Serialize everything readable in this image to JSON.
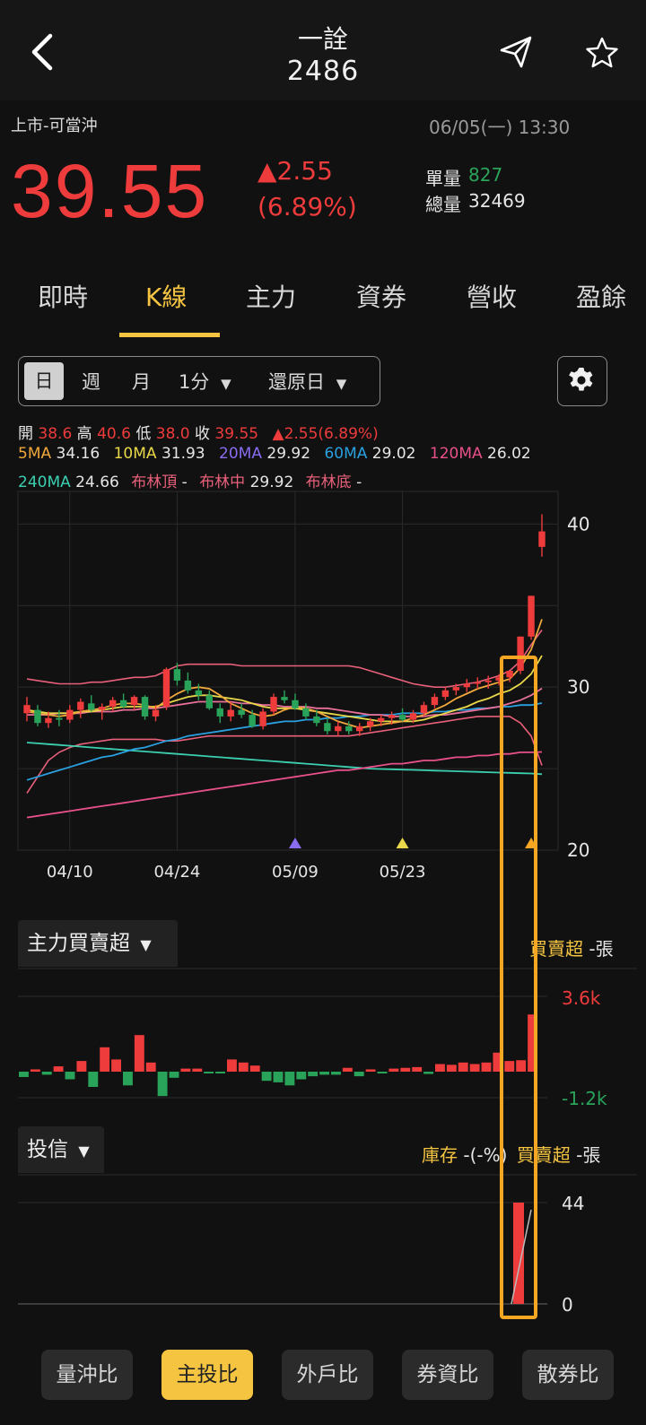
{
  "header": {
    "name": "一詮",
    "code": "2486"
  },
  "quote": {
    "market": "上市-可當沖",
    "datetime": "06/05(一) 13:30",
    "price": "39.55",
    "change": "▲2.55",
    "change_pct": "(6.89%)",
    "unit_vol_label": "單量",
    "unit_vol": "827",
    "total_vol_label": "總量",
    "total_vol": "32469"
  },
  "tabs": [
    "即時",
    "K線",
    "主力",
    "資券",
    "營收",
    "盈餘"
  ],
  "period": {
    "day": "日",
    "week": "週",
    "month": "月",
    "minute": "1分",
    "restore": "還原日"
  },
  "ohlc": {
    "open_label": "開",
    "open": "38.6",
    "high_label": "高",
    "high": "40.6",
    "low_label": "低",
    "low": "38.0",
    "close_label": "收",
    "close": "39.55",
    "change": "▲2.55(6.89%)"
  },
  "ma": {
    "ma5_label": "5MA",
    "ma5": "34.16",
    "ma10_label": "10MA",
    "ma10": "31.93",
    "ma20_label": "20MA",
    "ma20": "29.92",
    "ma60_label": "60MA",
    "ma60": "29.02",
    "ma120_label": "120MA",
    "ma120": "26.02",
    "ma240_label": "240MA",
    "ma240": "24.66",
    "boll_top_label": "布林頂",
    "boll_top": "-",
    "boll_mid_label": "布林中",
    "boll_mid": "29.92",
    "boll_bot_label": "布林底",
    "boll_bot": "-"
  },
  "colors": {
    "up": "#ee3b3b",
    "down": "#2aa35a",
    "accent": "#f5c542",
    "ma5": "#f0a83c",
    "ma10": "#e8d84a",
    "ma20": "#8a6cf0",
    "ma60": "#2aa0e0",
    "ma120": "#e8508a",
    "ma240": "#3ccfb0"
  },
  "chart_data": [
    {
      "type": "candlestick",
      "y_ticks": [
        "40",
        "30",
        "20"
      ],
      "ylim": [
        20,
        42
      ],
      "x_ticks": [
        "04/10",
        "04/24",
        "05/09",
        "05/23"
      ],
      "candles": [
        [
          28.4,
          29.4,
          27.9,
          28.9
        ],
        [
          28.6,
          28.9,
          27.6,
          27.8
        ],
        [
          27.8,
          28.5,
          27.5,
          28.1
        ],
        [
          28.1,
          28.6,
          27.6,
          28.0
        ],
        [
          28.0,
          28.9,
          27.8,
          28.6
        ],
        [
          28.6,
          29.3,
          28.1,
          29.1
        ],
        [
          29.0,
          29.5,
          28.5,
          28.6
        ],
        [
          28.6,
          29.0,
          28.0,
          28.8
        ],
        [
          28.8,
          29.4,
          28.5,
          29.2
        ],
        [
          29.2,
          29.6,
          28.7,
          28.8
        ],
        [
          28.9,
          29.5,
          28.6,
          29.4
        ],
        [
          29.4,
          29.5,
          28.0,
          28.2
        ],
        [
          28.2,
          28.9,
          27.9,
          28.6
        ],
        [
          28.8,
          31.2,
          28.6,
          31.1
        ],
        [
          31.1,
          31.5,
          30.1,
          30.4
        ],
        [
          30.4,
          30.9,
          29.6,
          29.8
        ],
        [
          29.8,
          30.2,
          29.2,
          29.5
        ],
        [
          29.5,
          29.8,
          28.6,
          28.7
        ],
        [
          28.7,
          29.0,
          27.8,
          28.2
        ],
        [
          28.2,
          29.1,
          27.9,
          28.6
        ],
        [
          28.6,
          29.0,
          28.1,
          28.3
        ],
        [
          28.3,
          28.6,
          27.5,
          27.6
        ],
        [
          27.6,
          28.7,
          27.4,
          28.5
        ],
        [
          28.5,
          29.6,
          28.3,
          29.4
        ],
        [
          29.4,
          29.8,
          29.0,
          29.2
        ],
        [
          29.2,
          29.6,
          28.6,
          28.7
        ],
        [
          28.7,
          29.0,
          28.0,
          28.2
        ],
        [
          28.2,
          28.6,
          27.6,
          27.8
        ],
        [
          27.8,
          28.1,
          27.1,
          27.3
        ],
        [
          27.3,
          27.9,
          27.0,
          27.6
        ],
        [
          27.6,
          27.9,
          27.1,
          27.3
        ],
        [
          27.3,
          27.8,
          27.0,
          27.6
        ],
        [
          27.6,
          28.1,
          27.3,
          27.9
        ],
        [
          27.9,
          28.3,
          27.6,
          28.1
        ],
        [
          28.1,
          28.5,
          27.7,
          28.3
        ],
        [
          28.3,
          28.7,
          27.9,
          28.0
        ],
        [
          28.0,
          28.6,
          27.8,
          28.4
        ],
        [
          28.4,
          29.1,
          28.2,
          28.9
        ],
        [
          28.9,
          29.6,
          28.7,
          29.4
        ],
        [
          29.4,
          30.0,
          29.2,
          29.8
        ],
        [
          29.8,
          30.2,
          29.5,
          30.0
        ],
        [
          30.0,
          30.5,
          29.7,
          30.2
        ],
        [
          30.2,
          30.6,
          29.9,
          30.3
        ],
        [
          30.3,
          30.7,
          29.9,
          30.4
        ],
        [
          30.4,
          30.8,
          30.1,
          30.6
        ],
        [
          30.6,
          31.0,
          30.3,
          31.0
        ],
        [
          31.0,
          33.1,
          30.8,
          33.1
        ],
        [
          33.1,
          35.6,
          32.9,
          35.6
        ],
        [
          38.6,
          40.6,
          38.0,
          39.55
        ]
      ],
      "ma5": [
        28.5,
        28.4,
        28.3,
        28.2,
        28.3,
        28.5,
        28.6,
        28.7,
        28.9,
        29.0,
        29.0,
        28.9,
        28.7,
        29.2,
        29.6,
        29.9,
        30.0,
        29.9,
        29.5,
        29.0,
        28.7,
        28.4,
        28.2,
        28.3,
        28.6,
        28.8,
        28.7,
        28.5,
        28.2,
        27.9,
        27.7,
        27.5,
        27.6,
        27.7,
        27.8,
        27.9,
        28.1,
        28.3,
        28.6,
        28.9,
        29.3,
        29.6,
        29.9,
        30.1,
        30.3,
        30.5,
        31.2,
        32.3,
        34.16
      ],
      "ma10": [
        28.6,
        28.5,
        28.4,
        28.4,
        28.4,
        28.5,
        28.5,
        28.6,
        28.7,
        28.8,
        28.8,
        28.8,
        28.8,
        29.0,
        29.2,
        29.4,
        29.5,
        29.5,
        29.4,
        29.3,
        29.2,
        29.0,
        28.8,
        28.7,
        28.7,
        28.7,
        28.6,
        28.5,
        28.4,
        28.3,
        28.2,
        28.1,
        28.0,
        27.9,
        27.9,
        27.9,
        27.9,
        28.0,
        28.2,
        28.4,
        28.6,
        28.8,
        29.1,
        29.3,
        29.6,
        29.8,
        30.2,
        30.8,
        31.93
      ],
      "ma20": [
        28.3,
        28.3,
        28.3,
        28.4,
        28.4,
        28.4,
        28.5,
        28.5,
        28.5,
        28.6,
        28.6,
        28.7,
        28.7,
        28.8,
        28.9,
        29.0,
        29.1,
        29.1,
        29.1,
        29.1,
        29.0,
        29.0,
        28.9,
        28.9,
        28.8,
        28.8,
        28.8,
        28.7,
        28.7,
        28.6,
        28.5,
        28.4,
        28.3,
        28.3,
        28.2,
        28.2,
        28.2,
        28.2,
        28.3,
        28.3,
        28.4,
        28.5,
        28.6,
        28.7,
        28.8,
        29.0,
        29.2,
        29.5,
        29.92
      ],
      "ma60": [
        24.3,
        24.5,
        24.7,
        24.9,
        25.1,
        25.3,
        25.5,
        25.7,
        25.8,
        26.0,
        26.2,
        26.3,
        26.5,
        26.7,
        26.8,
        27.0,
        27.1,
        27.2,
        27.3,
        27.4,
        27.5,
        27.6,
        27.7,
        27.8,
        27.9,
        27.9,
        28.0,
        28.0,
        28.1,
        28.1,
        28.2,
        28.2,
        28.3,
        28.3,
        28.3,
        28.4,
        28.4,
        28.4,
        28.5,
        28.5,
        28.6,
        28.6,
        28.7,
        28.7,
        28.8,
        28.8,
        28.9,
        28.9,
        29.02
      ],
      "ma120": [
        22.0,
        22.1,
        22.2,
        22.3,
        22.4,
        22.5,
        22.6,
        22.7,
        22.8,
        22.9,
        23.0,
        23.1,
        23.2,
        23.3,
        23.4,
        23.5,
        23.6,
        23.7,
        23.8,
        23.9,
        24.0,
        24.1,
        24.2,
        24.3,
        24.4,
        24.5,
        24.6,
        24.7,
        24.8,
        24.9,
        24.9,
        25.0,
        25.1,
        25.2,
        25.3,
        25.3,
        25.4,
        25.5,
        25.5,
        25.6,
        25.7,
        25.7,
        25.8,
        25.8,
        25.9,
        25.9,
        26.0,
        26.0,
        26.02
      ],
      "ma240": [
        26.6,
        26.55,
        26.5,
        26.45,
        26.4,
        26.35,
        26.3,
        26.25,
        26.2,
        26.15,
        26.1,
        26.05,
        26.0,
        25.95,
        25.9,
        25.85,
        25.8,
        25.75,
        25.7,
        25.65,
        25.6,
        25.55,
        25.5,
        25.45,
        25.4,
        25.35,
        25.3,
        25.25,
        25.2,
        25.15,
        25.1,
        25.05,
        25.0,
        24.98,
        24.96,
        24.94,
        24.92,
        24.9,
        24.88,
        24.86,
        24.84,
        24.82,
        24.8,
        24.78,
        24.76,
        24.74,
        24.72,
        24.7,
        24.66
      ],
      "boll_upper": [
        30.5,
        30.4,
        30.3,
        30.2,
        30.2,
        30.2,
        30.3,
        30.3,
        30.4,
        30.5,
        30.6,
        30.6,
        30.7,
        31.0,
        31.3,
        31.4,
        31.4,
        31.4,
        31.4,
        31.4,
        31.3,
        31.3,
        31.3,
        31.3,
        31.3,
        31.3,
        31.3,
        31.3,
        31.3,
        31.3,
        31.3,
        31.2,
        31.0,
        30.8,
        30.6,
        30.4,
        30.2,
        30.1,
        30.0,
        30.0,
        30.1,
        30.2,
        30.3,
        30.5,
        30.7,
        31.0,
        31.6,
        32.6,
        33.5
      ],
      "boll_lower": [
        23.5,
        24.5,
        25.5,
        26.0,
        26.3,
        26.5,
        26.6,
        26.7,
        26.8,
        26.8,
        26.8,
        26.8,
        26.8,
        26.7,
        26.7,
        26.8,
        26.9,
        27.0,
        27.0,
        27.0,
        27.0,
        27.0,
        27.0,
        27.0,
        27.0,
        27.0,
        27.0,
        27.0,
        27.0,
        27.0,
        27.0,
        27.1,
        27.2,
        27.3,
        27.4,
        27.5,
        27.6,
        27.7,
        27.8,
        27.9,
        28.0,
        28.1,
        28.2,
        28.2,
        28.2,
        28.2,
        27.8,
        27.0,
        25.2
      ]
    },
    {
      "type": "bar",
      "title": "主力買賣超",
      "y_ticks": [
        "3.6k",
        "-1.2k"
      ],
      "values": [
        -0.35,
        0.15,
        -0.2,
        0.35,
        -0.5,
        0.7,
        -1.0,
        1.6,
        0.8,
        -0.9,
        2.4,
        0.6,
        -1.6,
        -0.4,
        0.2,
        0.2,
        -0.1,
        -0.05,
        0.8,
        0.6,
        0.4,
        -0.6,
        -0.7,
        -0.9,
        -0.5,
        -0.3,
        -0.2,
        -0.2,
        0.25,
        -0.3,
        0.15,
        -0.1,
        0.2,
        0.25,
        0.3,
        -0.15,
        0.5,
        0.45,
        0.6,
        0.5,
        0.6,
        1.25,
        0.7,
        0.75,
        3.75
      ]
    },
    {
      "type": "bar",
      "title": "投信",
      "y_ticks": [
        "44",
        "0"
      ],
      "values": [
        0,
        0,
        0,
        0,
        0,
        0,
        0,
        0,
        0,
        0,
        0,
        0,
        0,
        0,
        0,
        0,
        0,
        0,
        0,
        0,
        0,
        0,
        0,
        0,
        0,
        0,
        0,
        0,
        0,
        0,
        0,
        0,
        0,
        0,
        0,
        0,
        0,
        0,
        0,
        0,
        0,
        0,
        0,
        0,
        0,
        0,
        0,
        0,
        44
      ]
    }
  ],
  "sub1": {
    "title": "主力買賣超",
    "right_label": "買賣超",
    "right_unit": "-張"
  },
  "sub2": {
    "title": "投信",
    "inv_label": "庫存",
    "inv_value": "-(-%)",
    "right_label": "買賣超",
    "right_unit": "-張"
  },
  "bottom": [
    "量沖比",
    "主投比",
    "外戶比",
    "券資比",
    "散券比"
  ]
}
